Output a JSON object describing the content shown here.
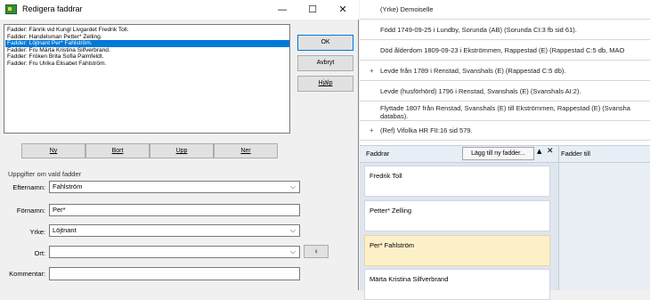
{
  "dialog": {
    "title": "Redigera faddrar",
    "controls": {
      "minimize": "—",
      "maximize": "☐",
      "close": "✕"
    },
    "list_items": [
      "Fadder: Fänrik vid Kungl Livgardet Fredrik Toll.",
      "Fadder: Handelsman Petter* Zelling.",
      "Fadder: Löjtnant Per* Fahlström.",
      "Fadder: Fru Märta Kristina Silfverbrand.",
      "Fadder: Fröken Brita Sofia Palmfeldt.",
      "Fadder: Fru Ulrika Elisabet Fahlström."
    ],
    "selected_index": 2,
    "buttons": {
      "ok": "OK",
      "cancel": "Avbryt",
      "help": "Hjälp",
      "new": "Ny",
      "remove": "Bort",
      "up": "Upp",
      "down": "Ner"
    },
    "details": {
      "title": "Uppgifter om vald fadder",
      "surname_label": "Efternamn:",
      "surname_value": "Fahlström",
      "firstname_label": "Förnamn:",
      "firstname_value": "Per*",
      "occupation_label": "Yrke:",
      "occupation_value": "Löjtnant",
      "place_label": "Ort:",
      "place_value": "",
      "comment_label": "Kommentar:",
      "comment_value": ""
    },
    "chevron": "⌵",
    "pin_glyph": "♀"
  },
  "events": [
    {
      "text": "(Yrke) Demoiselle",
      "plus": ""
    },
    {
      "text": "Född 1749-09-25 i Lundby, Sorunda (AB) (Sorunda CI:3 fb sid 61).",
      "plus": ""
    },
    {
      "text": "Död ålderdom 1809-09-23 i Ekströmmen, Rappestad (E) (Rappestad C:5 db, MAO",
      "plus": ""
    },
    {
      "text": "Levde från 1789 i Renstad, Svanshals (E) (Rappestad C:5 db).",
      "plus": "+"
    },
    {
      "text": "Levde (husförhörd) 1796 i Renstad, Svanshals (E) (Svanshals AI:2).",
      "plus": ""
    },
    {
      "text": "Flyttade 1807 från Renstad, Svanshals (E) till Ekströmmen, Rappestad (E) (Svansha",
      "text2": "databas).",
      "plus": ""
    },
    {
      "text": "(Ref) Vifolka HR FII:16 sid 579.",
      "plus": "+"
    }
  ],
  "faddrar_panel": {
    "header": "Faddrar",
    "add_button": "Lägg till ny fadder...",
    "arrow": "▲",
    "close": "✕",
    "cards": [
      "Fredrik Toll",
      "Petter* Zelling",
      "Per* Fahlström",
      "Märta Kristina Silfverbrand"
    ],
    "selected_card": 2
  },
  "fadder_till": {
    "header": "Fadder till"
  }
}
